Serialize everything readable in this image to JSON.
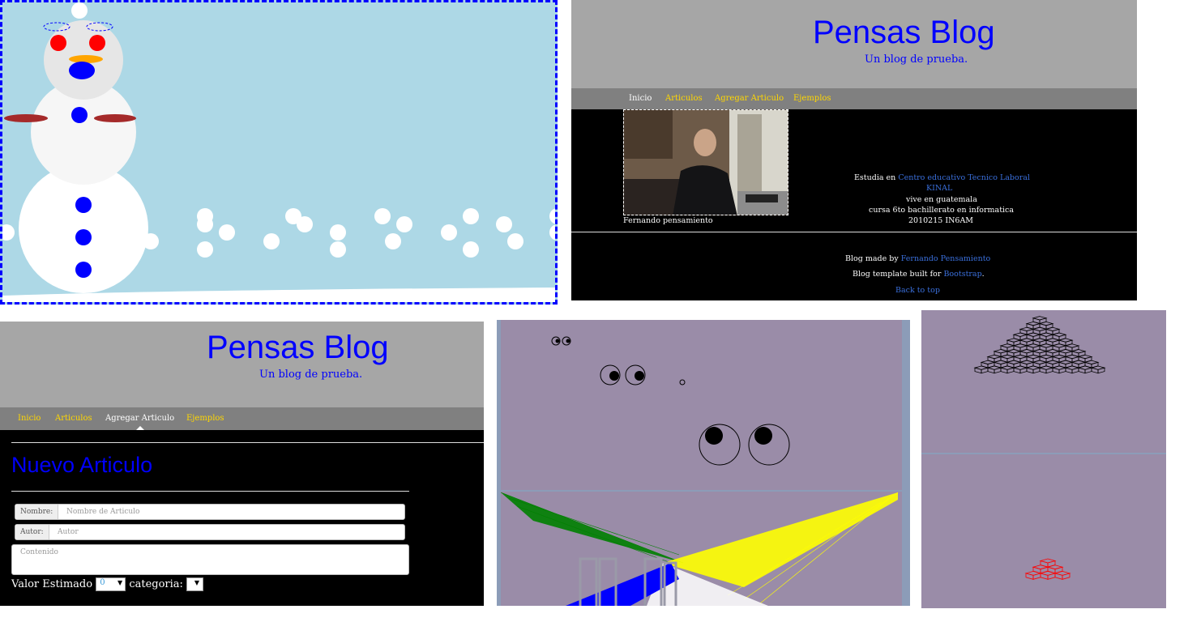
{
  "snowman_panel": {
    "colors": {
      "sky": "#add8e6",
      "snow": "#ffffff",
      "buttons": "#0000ff",
      "eyes": "#ff0000",
      "nose": "#ffa500",
      "arms": "#a52a2a"
    }
  },
  "blog_home": {
    "title": "Pensas Blog",
    "subtitle": "Un blog de prueba.",
    "nav": [
      "Inicio",
      "Articulos",
      "Agregar Articulo",
      "Ejemplos"
    ],
    "active_nav": "Inicio",
    "photo_caption": "Fernando pensamiento",
    "bio": {
      "studies_prefix": "Estudia en ",
      "school": "Centro educativo Tecnico Laboral",
      "school2": "KINAL",
      "lives": "vive en guatemala",
      "course": "cursa 6to bachillerato en informatica",
      "code": "2010215 IN6AM"
    },
    "footer": {
      "made_prefix": "Blog made by ",
      "author": "Fernando Pensamiento",
      "template_prefix": "Blog template built for ",
      "bootstrap": "Bootstrap",
      "template_suffix": ".",
      "back_to_top": "Back to top"
    }
  },
  "blog_form": {
    "title": "Pensas Blog",
    "subtitle": "Un blog de prueba.",
    "nav": [
      "Inicio",
      "Articulos",
      "Agregar Articulo",
      "Ejemplos"
    ],
    "active_nav": "Agregar Articulo",
    "heading": "Nuevo Articulo",
    "fields": {
      "name_label": "Nombre:",
      "name_placeholder": "Nombre de Articulo",
      "author_label": "Autor:",
      "author_placeholder": "Autor",
      "content_placeholder": "Contenido",
      "value_label": "Valor Estimado",
      "value_selected": "0",
      "category_label": "categoria:",
      "category_selected": ""
    }
  },
  "eyes_panel": {
    "colors": {
      "background": "#9a8ca8",
      "green": "#008000",
      "yellow": "#ffff00",
      "blue": "#0000ff",
      "white": "#ffffff"
    }
  },
  "cubes_panel": {
    "colors": {
      "background": "#9a8ca8",
      "large_pyramid": "#000000",
      "small_pyramid": "#ff0000"
    }
  }
}
